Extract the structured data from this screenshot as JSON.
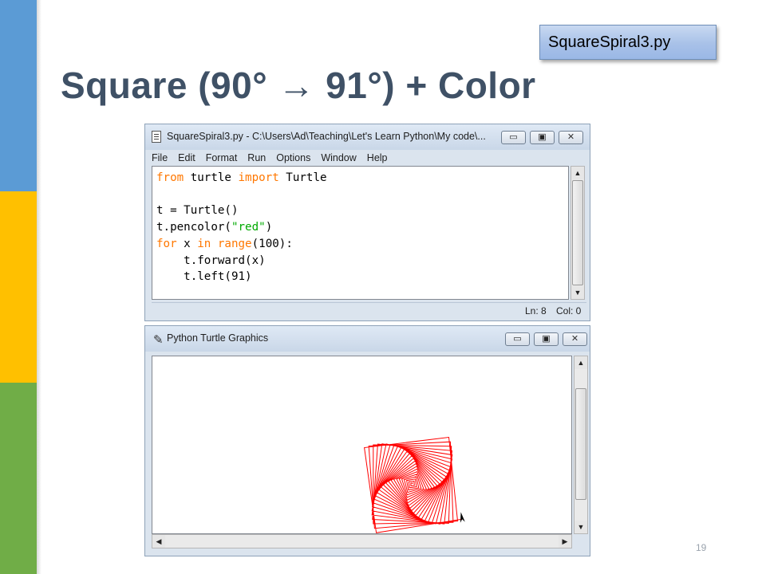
{
  "slide": {
    "title": "Square (90° → 91°) + Color",
    "callout": "SquareSpiral3.py",
    "page_number": "19"
  },
  "editor_window": {
    "title": "SquareSpiral3.py - C:\\Users\\Ad\\Teaching\\Let's Learn Python\\My code\\...",
    "icon": "python-file-icon",
    "buttons": {
      "minimize": "▭",
      "maximize": "▣",
      "close": "✕"
    },
    "menu": [
      "File",
      "Edit",
      "Format",
      "Run",
      "Options",
      "Window",
      "Help"
    ],
    "code": {
      "line1": {
        "kw1": "from",
        "mid": " turtle ",
        "kw2": "import",
        "end": " Turtle"
      },
      "line3": "t = Turtle()",
      "line4": {
        "pre": "t.pencolor(",
        "str": "\"red\"",
        "post": ")"
      },
      "line5": {
        "kw1": "for",
        "mid1": " x ",
        "kw2": "in",
        "mid2": " ",
        "kw3": "range",
        "end": "(100):"
      },
      "line6": "    t.forward(x)",
      "line7": "    t.left(91)"
    },
    "status": {
      "line": "Ln: 8",
      "col": "Col: 0"
    },
    "colors": {
      "keyword": "#ff7700",
      "string": "#00aa00"
    }
  },
  "turtle_window": {
    "title": "Python Turtle Graphics",
    "icon": "feather-icon",
    "buttons": {
      "minimize": "▭",
      "maximize": "▣",
      "close": "✕"
    },
    "drawing": {
      "pen_color": "#ff0000",
      "steps": 100,
      "turn_degrees": 91,
      "step_increment": 1
    }
  }
}
